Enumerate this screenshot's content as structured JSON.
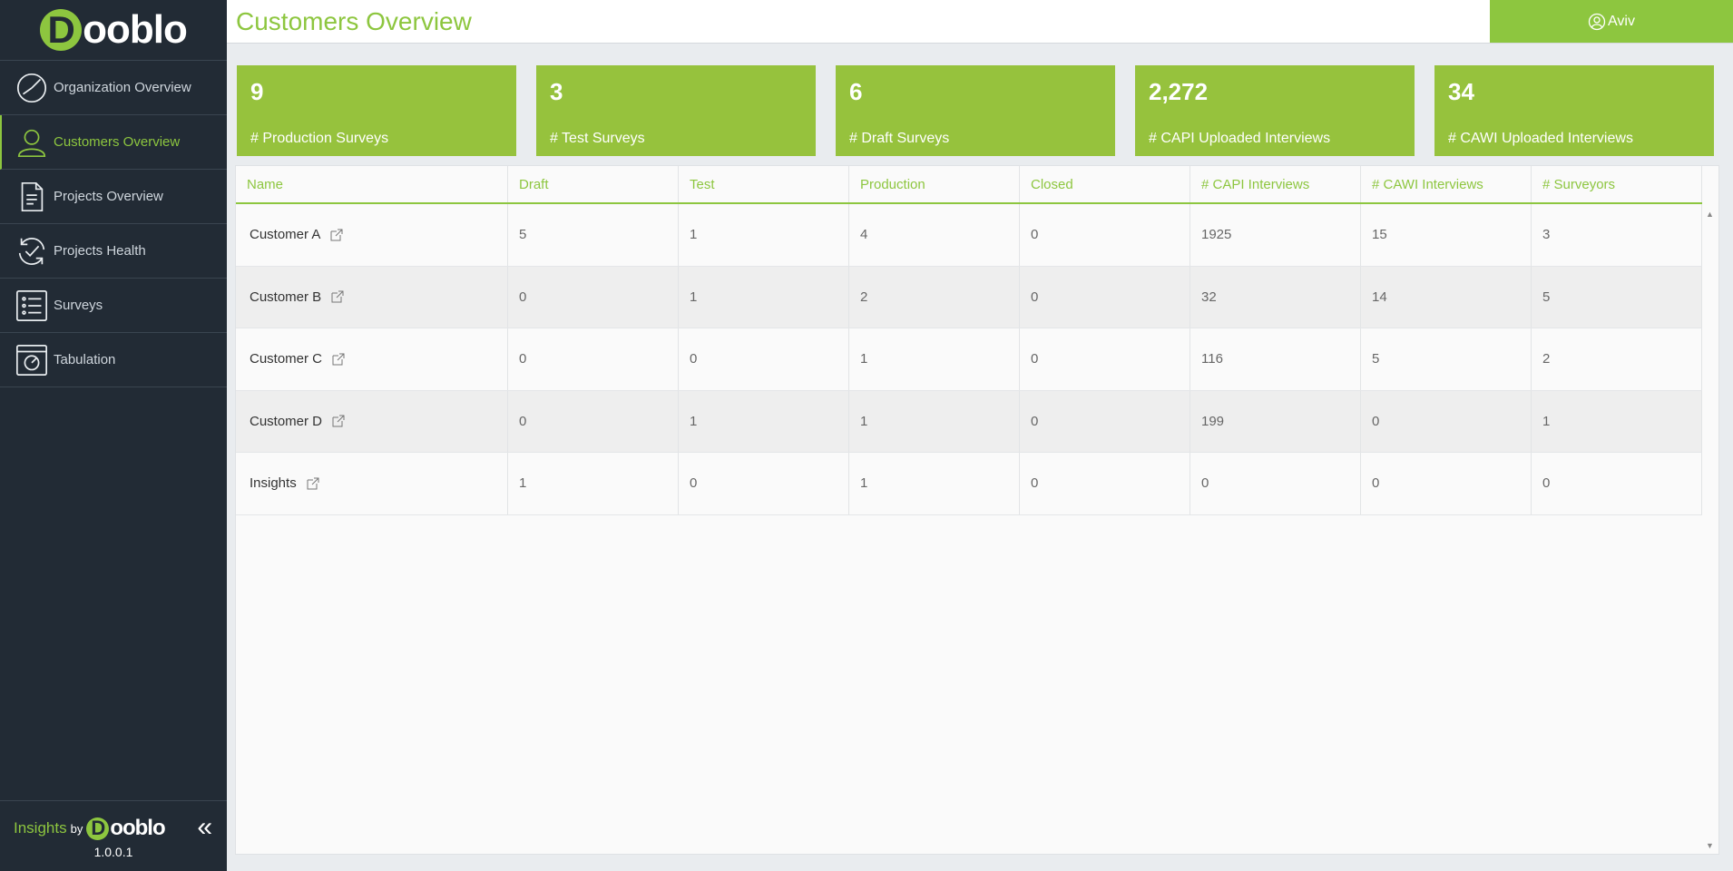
{
  "sidebar": {
    "logo": {
      "initial": "D",
      "rest": "ooblo"
    },
    "items": [
      {
        "label": "Organization Overview",
        "icon": "pie-chart-icon",
        "active": false
      },
      {
        "label": "Customers Overview",
        "icon": "user-icon",
        "active": true
      },
      {
        "label": "Projects Overview",
        "icon": "document-icon",
        "active": false
      },
      {
        "label": "Projects Health",
        "icon": "refresh-check-icon",
        "active": false
      },
      {
        "label": "Surveys",
        "icon": "list-icon",
        "active": false
      },
      {
        "label": "Tabulation",
        "icon": "tabulation-icon",
        "active": false
      }
    ],
    "footer": {
      "insights": "Insights",
      "by": "by",
      "logo_initial": "D",
      "logo_rest": "ooblo",
      "version": "1.0.0.1",
      "collapse": "«"
    }
  },
  "header": {
    "title": "Customers Overview",
    "user": "Aviv"
  },
  "cards": [
    {
      "value": "9",
      "label": "# Production Surveys"
    },
    {
      "value": "3",
      "label": "# Test Surveys"
    },
    {
      "value": "6",
      "label": "# Draft Surveys"
    },
    {
      "value": "2,272",
      "label": "# CAPI Uploaded Interviews"
    },
    {
      "value": "34",
      "label": "# CAWI Uploaded Interviews"
    }
  ],
  "table": {
    "columns": [
      "Name",
      "Draft",
      "Test",
      "Production",
      "Closed",
      "# CAPI Interviews",
      "# CAWI Interviews",
      "# Surveyors"
    ],
    "rows": [
      [
        "Customer A",
        "5",
        "1",
        "4",
        "0",
        "1925",
        "15",
        "3"
      ],
      [
        "Customer B",
        "0",
        "1",
        "2",
        "0",
        "32",
        "14",
        "5"
      ],
      [
        "Customer C",
        "0",
        "0",
        "1",
        "0",
        "116",
        "5",
        "2"
      ],
      [
        "Customer D",
        "0",
        "1",
        "1",
        "0",
        "199",
        "0",
        "1"
      ],
      [
        "Insights",
        "1",
        "0",
        "1",
        "0",
        "0",
        "0",
        "0"
      ]
    ]
  },
  "colors": {
    "accent": "#8dc63f",
    "card": "#96c23d",
    "sidebar": "#222b35"
  }
}
